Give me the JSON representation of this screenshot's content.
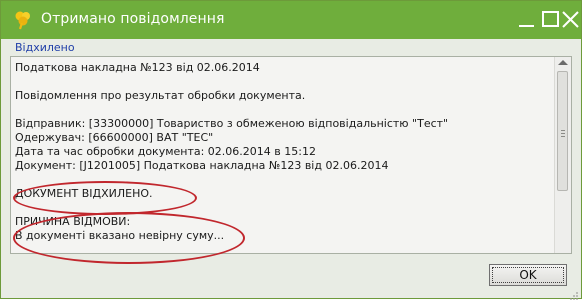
{
  "window": {
    "title": "Отримано повідомлення",
    "controls": {
      "minimize_icon": "minimize-icon",
      "maximize_icon": "maximize-icon",
      "close_icon": "close-icon"
    },
    "colors": {
      "titlebar": "#6fae3c",
      "frame": "#e8ece4",
      "status_text": "#1f3ea8",
      "highlight_ellipse": "#c1272d"
    }
  },
  "status": {
    "label": "Відхилено"
  },
  "message": {
    "header": "Податкова накладна  №123 від 02.06.2014",
    "intro": "Повідомлення про результат обробки документа.",
    "sender": "Відправник: [33300000] Товариство з обмеженою відповідальністю \"Тест\"",
    "recipient": "Одержувач:  [66600000] ВАТ \"ТЕС\"",
    "processed_at": "Дата та час обробки документа: 02.06.2014 в 15:12",
    "document": "Документ: [J1201005] Податкова накладна  №123 від 02.06.2014",
    "result": "ДОКУМЕНТ ВІДХИЛЕНО.",
    "reason_title": "ПРИЧИНА ВІДМОВИ:",
    "reason_text": "В документі вказано невірну суму..."
  },
  "buttons": {
    "ok_label": "OK"
  },
  "icons": {
    "app": "flower-logo-icon",
    "scroll_up": "scroll-up-arrow-icon",
    "resize": "resize-grip-icon"
  }
}
